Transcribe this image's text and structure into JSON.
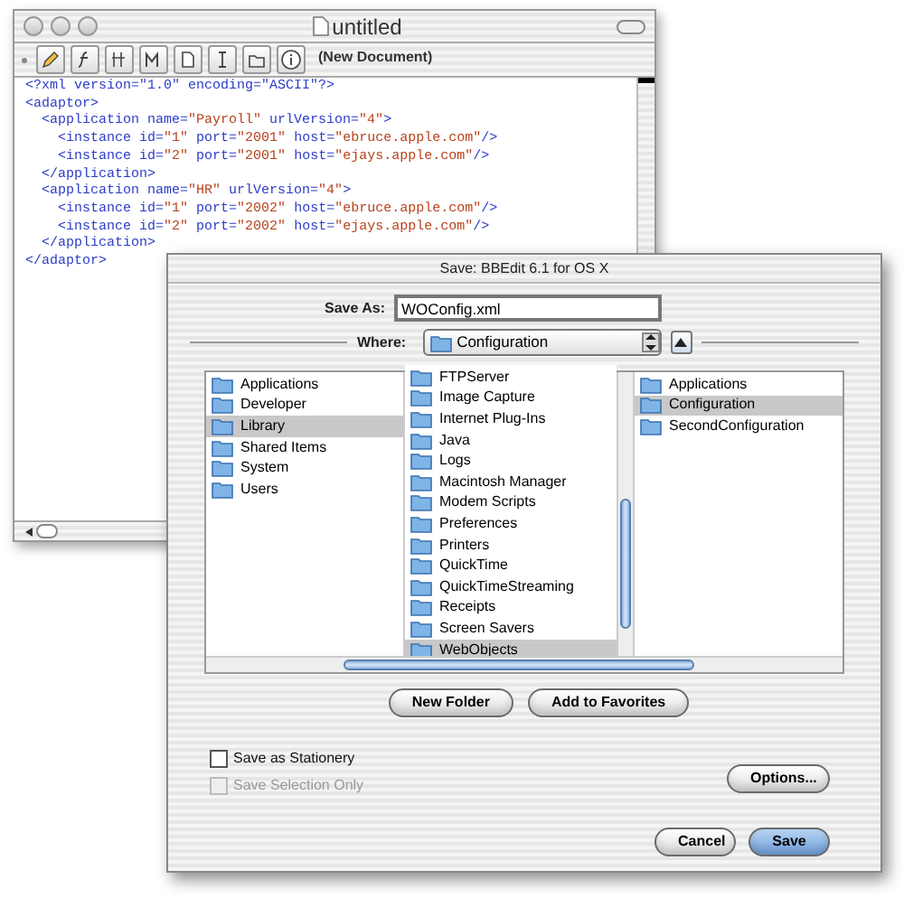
{
  "editor": {
    "title": "untitled",
    "toolbar_label": "(New Document)",
    "lines": [
      [
        {
          "kind": "markup",
          "text": "<?xml version=\"1.0\" encoding=\"ASCII\"?>"
        }
      ],
      [
        {
          "kind": "markup",
          "text": "<adaptor>"
        }
      ],
      [
        {
          "kind": "markup",
          "text": "  <application name="
        },
        {
          "kind": "string",
          "text": "\"Payroll\""
        },
        {
          "kind": "markup",
          "text": " urlVersion="
        },
        {
          "kind": "string",
          "text": "\"4\""
        },
        {
          "kind": "markup",
          "text": ">"
        }
      ],
      [
        {
          "kind": "markup",
          "text": "    <instance id="
        },
        {
          "kind": "string",
          "text": "\"1\""
        },
        {
          "kind": "markup",
          "text": " port="
        },
        {
          "kind": "string",
          "text": "\"2001\""
        },
        {
          "kind": "markup",
          "text": " host="
        },
        {
          "kind": "string",
          "text": "\"ebruce.apple.com\""
        },
        {
          "kind": "markup",
          "text": "/>"
        }
      ],
      [
        {
          "kind": "markup",
          "text": "    <instance id="
        },
        {
          "kind": "string",
          "text": "\"2\""
        },
        {
          "kind": "markup",
          "text": " port="
        },
        {
          "kind": "string",
          "text": "\"2001\""
        },
        {
          "kind": "markup",
          "text": " host="
        },
        {
          "kind": "string",
          "text": "\"ejays.apple.com\""
        },
        {
          "kind": "markup",
          "text": "/>"
        }
      ],
      [
        {
          "kind": "markup",
          "text": "  </application>"
        }
      ],
      [
        {
          "kind": "markup",
          "text": "  <application name="
        },
        {
          "kind": "string",
          "text": "\"HR\""
        },
        {
          "kind": "markup",
          "text": " urlVersion="
        },
        {
          "kind": "string",
          "text": "\"4\""
        },
        {
          "kind": "markup",
          "text": ">"
        }
      ],
      [
        {
          "kind": "markup",
          "text": "    <instance id="
        },
        {
          "kind": "string",
          "text": "\"1\""
        },
        {
          "kind": "markup",
          "text": " port="
        },
        {
          "kind": "string",
          "text": "\"2002\""
        },
        {
          "kind": "markup",
          "text": " host="
        },
        {
          "kind": "string",
          "text": "\"ebruce.apple.com\""
        },
        {
          "kind": "markup",
          "text": "/>"
        }
      ],
      [
        {
          "kind": "markup",
          "text": "    <instance id="
        },
        {
          "kind": "string",
          "text": "\"2\""
        },
        {
          "kind": "markup",
          "text": " port="
        },
        {
          "kind": "string",
          "text": "\"2002\""
        },
        {
          "kind": "markup",
          "text": " host="
        },
        {
          "kind": "string",
          "text": "\"ejays.apple.com\""
        },
        {
          "kind": "markup",
          "text": "/>"
        }
      ],
      [
        {
          "kind": "markup",
          "text": "  </application>"
        }
      ],
      [
        {
          "kind": "markup",
          "text": "</adaptor>"
        }
      ]
    ]
  },
  "dialog": {
    "title": "Save: BBEdit 6.1 for OS X",
    "save_as_label": "Save As:",
    "save_as_value": "WOConfig.xml",
    "where_label": "Where:",
    "where_value": "Configuration",
    "columns": [
      [
        {
          "label": "Applications",
          "selected": false
        },
        {
          "label": "Developer",
          "selected": false
        },
        {
          "label": "Library",
          "selected": true
        },
        {
          "label": "Shared Items",
          "selected": false
        },
        {
          "label": "System",
          "selected": false
        },
        {
          "label": "Users",
          "selected": false
        }
      ],
      [
        {
          "label": "FTPServer",
          "selected": false
        },
        {
          "label": "Image Capture",
          "selected": false
        },
        {
          "label": "Internet Plug-Ins",
          "selected": false
        },
        {
          "label": "Java",
          "selected": false
        },
        {
          "label": "Logs",
          "selected": false
        },
        {
          "label": "Macintosh Manager",
          "selected": false
        },
        {
          "label": "Modem Scripts",
          "selected": false
        },
        {
          "label": "Preferences",
          "selected": false
        },
        {
          "label": "Printers",
          "selected": false
        },
        {
          "label": "QuickTime",
          "selected": false
        },
        {
          "label": "QuickTimeStreaming",
          "selected": false
        },
        {
          "label": "Receipts",
          "selected": false
        },
        {
          "label": "Screen Savers",
          "selected": false
        },
        {
          "label": "WebObjects",
          "selected": true
        }
      ],
      [
        {
          "label": "Applications",
          "selected": false
        },
        {
          "label": "Configuration",
          "selected": true
        },
        {
          "label": "SecondConfiguration",
          "selected": false
        }
      ]
    ],
    "browser_buttons": [
      "New Folder",
      "Add to Favorites"
    ],
    "options": [
      {
        "label": "Save as Stationery",
        "checked": false,
        "disabled": false
      },
      {
        "label": "Save Selection Only",
        "checked": false,
        "disabled": true
      }
    ],
    "options_button": "Options...",
    "buttons": [
      {
        "label": "Cancel",
        "default": false
      },
      {
        "label": "Save",
        "default": true
      }
    ]
  }
}
